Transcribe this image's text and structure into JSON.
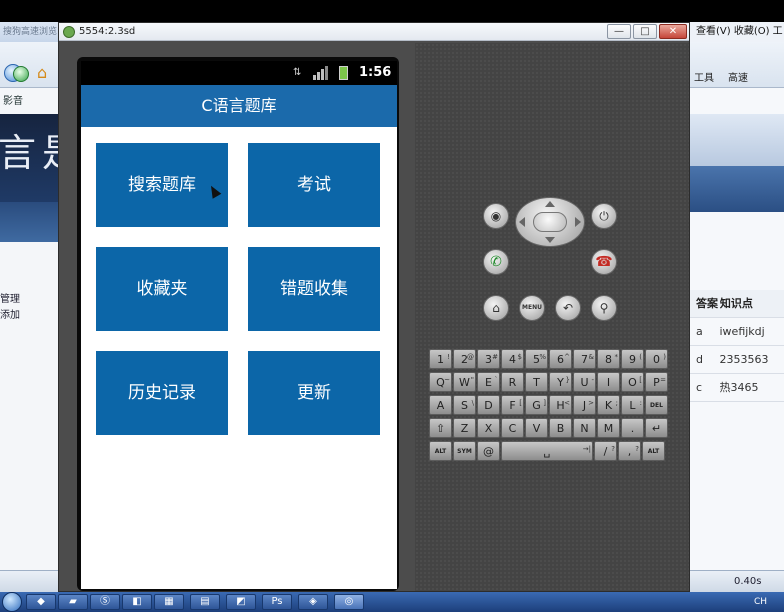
{
  "left_browser": {
    "title": "搜狗高速浏览",
    "favorites": "影音",
    "links": [
      "管理",
      "添加"
    ],
    "banner_text": "言是"
  },
  "right_browser": {
    "menu": "查看(V)  收藏(O)  工",
    "toolbar_1": "高速",
    "toolbar_2": "工具",
    "table_header": [
      "答案",
      "知识点"
    ],
    "table_rows": [
      [
        "a",
        "iwefijkdj"
      ],
      [
        "d",
        "2353563"
      ],
      [
        "c",
        "热3465"
      ]
    ],
    "speed": "0.40s"
  },
  "emulator": {
    "title": "5554:2.3sd",
    "window_buttons": {
      "minimize": "—",
      "maximize": "□",
      "close": "✕"
    }
  },
  "phone": {
    "status_time": "1:56",
    "app_title": "C语言题库",
    "tiles": {
      "search": "搜索题库",
      "exam": "考试",
      "favorites": "收藏夹",
      "wrong": "错题收集",
      "history": "历史记录",
      "update": "更新"
    }
  },
  "hardware_buttons": {
    "menu": "MENU"
  },
  "keyboard": {
    "row1": [
      [
        "1",
        "!"
      ],
      [
        "2",
        "@"
      ],
      [
        "3",
        "#"
      ],
      [
        "4",
        "$"
      ],
      [
        "5",
        "%"
      ],
      [
        "6",
        "^"
      ],
      [
        "7",
        "&"
      ],
      [
        "8",
        "*"
      ],
      [
        "9",
        "("
      ],
      [
        "0",
        ")"
      ]
    ],
    "row2": [
      [
        "Q",
        "~"
      ],
      [
        "W",
        "\""
      ],
      [
        "E",
        "`"
      ],
      [
        "R",
        ""
      ],
      [
        "T",
        ""
      ],
      [
        "Y",
        "}"
      ],
      [
        "U",
        "-"
      ],
      [
        "I",
        ""
      ],
      [
        "O",
        "["
      ],
      [
        "P",
        "="
      ]
    ],
    "row3": [
      [
        "A",
        ""
      ],
      [
        "S",
        "\\"
      ],
      [
        "D",
        ""
      ],
      [
        "F",
        "["
      ],
      [
        "G",
        "]"
      ],
      [
        "H",
        "<"
      ],
      [
        "J",
        ">"
      ],
      [
        "K",
        ";"
      ],
      [
        "L",
        ":"
      ],
      [
        "DEL",
        ""
      ]
    ],
    "row4": [
      [
        "⇧",
        ""
      ],
      [
        "Z",
        ""
      ],
      [
        "X",
        ""
      ],
      [
        "C",
        ""
      ],
      [
        "V",
        ""
      ],
      [
        "B",
        ""
      ],
      [
        "N",
        ""
      ],
      [
        "M",
        ""
      ],
      [
        ".",
        ""
      ],
      [
        "↵",
        ""
      ]
    ],
    "row5": [
      [
        "ALT",
        ""
      ],
      [
        "SYM",
        ""
      ],
      [
        "@",
        ""
      ],
      [
        "␣",
        "→|"
      ],
      [
        "/",
        "?"
      ],
      [
        ",",
        "?"
      ],
      [
        "ALT",
        ""
      ]
    ]
  },
  "taskbar": {
    "tray": "CH"
  }
}
